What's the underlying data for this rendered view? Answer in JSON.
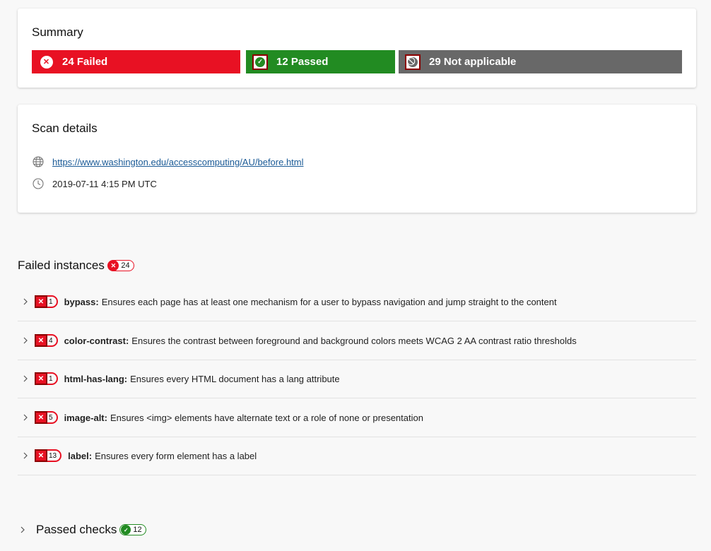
{
  "summary": {
    "title": "Summary",
    "failed_label": "24 Failed",
    "passed_label": "12 Passed",
    "not_applicable_label": "29 Not applicable"
  },
  "scan_details": {
    "title": "Scan details",
    "url": "https://www.washington.edu/accesscomputing/AU/before.html",
    "timestamp": "2019-07-11 4:15 PM UTC"
  },
  "failed_instances": {
    "title": "Failed instances",
    "count": "24",
    "rules": [
      {
        "name": "bypass:",
        "count": "1",
        "description": "Ensures each page has at least one mechanism for a user to bypass navigation and jump straight to the content"
      },
      {
        "name": "color-contrast:",
        "count": "4",
        "description": "Ensures the contrast between foreground and background colors meets WCAG 2 AA contrast ratio thresholds"
      },
      {
        "name": "html-has-lang:",
        "count": "1",
        "description": "Ensures every HTML document has a lang attribute"
      },
      {
        "name": "image-alt:",
        "count": "5",
        "description": "Ensures <img> elements have alternate text or a role of none or presentation"
      },
      {
        "name": "label:",
        "count": "13",
        "description": "Ensures every form element has a label"
      }
    ]
  },
  "passed_checks": {
    "title": "Passed checks",
    "count": "12"
  },
  "colors": {
    "failed": "#e81123",
    "passed": "#228b22",
    "not_applicable": "#686868",
    "link": "#1a5a96"
  },
  "icons": [
    "failed-x-icon",
    "passed-check-icon",
    "not-applicable-icon",
    "globe-icon",
    "clock-icon",
    "chevron-right-icon"
  ]
}
